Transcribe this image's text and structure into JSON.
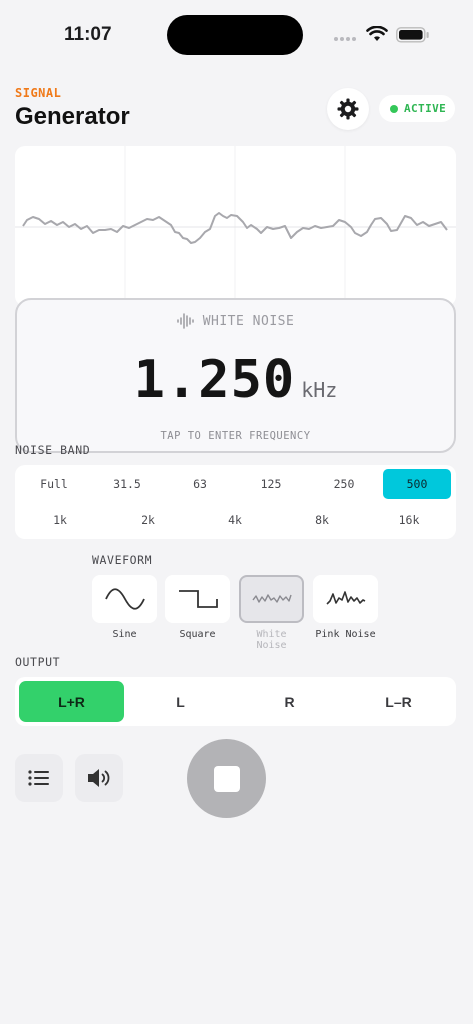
{
  "status_bar": {
    "time": "11:07"
  },
  "header": {
    "eyebrow": "SIGNAL",
    "title": "Generator",
    "status": "ACTIVE",
    "status_color": "#34c759"
  },
  "generator": {
    "type_label": "WHITE NOISE",
    "value": "1.250",
    "unit": "kHz",
    "hint": "TAP TO ENTER FREQUENCY"
  },
  "noise_band": {
    "label": "NOISE BAND",
    "row1": [
      "Full",
      "31.5",
      "63",
      "125",
      "250",
      "500"
    ],
    "row2": [
      "1k",
      "2k",
      "4k",
      "8k",
      "16k"
    ],
    "selected": "500",
    "accent": "#00c8dc"
  },
  "waveform": {
    "label": "WAVEFORM",
    "options": [
      {
        "label": "Sine",
        "icon": "sine-wave-icon"
      },
      {
        "label": "Square",
        "icon": "square-wave-icon"
      },
      {
        "label": "White Noise",
        "icon": "white-noise-icon"
      },
      {
        "label": "Pink Noise",
        "icon": "pink-noise-icon"
      }
    ],
    "selected": "White Noise"
  },
  "output": {
    "label": "OUTPUT",
    "options": [
      "L+R",
      "L",
      "R",
      "L–R"
    ],
    "selected": "L+R",
    "accent": "#33d16b"
  },
  "controls": {
    "list_icon": "list-icon",
    "speaker_icon": "speaker-icon",
    "stop_icon": "stop-icon"
  }
}
